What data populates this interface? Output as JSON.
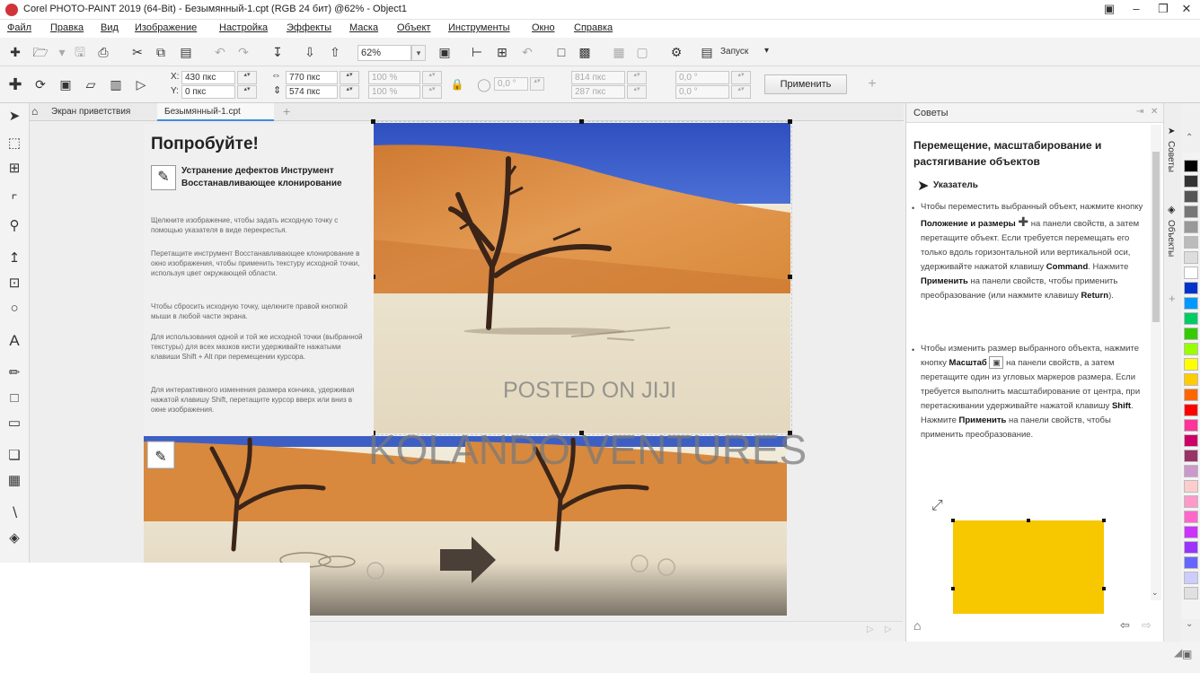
{
  "app": {
    "title": "Corel PHOTO-PAINT 2019 (64-Bit) - Безымянный-1.cpt (RGB 24 бит) @62% - Object1"
  },
  "menu": [
    "Файл",
    "Правка",
    "Вид",
    "Изображение",
    "Настройка",
    "Эффекты",
    "Маска",
    "Объект",
    "Инструменты",
    "Окно",
    "Справка"
  ],
  "toolbar1": {
    "zoom_value": "62%",
    "run_label": "Запуск"
  },
  "toolbar2": {
    "x_label": "X:",
    "y_label": "Y:",
    "x_value": "430 пкс",
    "y_value": "0 пкс",
    "w_value": "770 пкс",
    "h_value": "574 пкс",
    "scale_w": "100 %",
    "scale_h": "100 %",
    "angle": "0,0 °",
    "cx": "814 пкс",
    "cy": "287 пкс",
    "skew_h": "0,0 °",
    "skew_v": "0,0 °",
    "apply_label": "Применить"
  },
  "doc_tabs": [
    "Экран приветствия",
    "Безымянный-1.cpt"
  ],
  "try_panel": {
    "title": "Попробуйте!",
    "heading": "Устранение дефектов Инструмент Восстанавливающее клонирование",
    "paragraphs": [
      "Щелкните изображение, чтобы задать исходную точку с помощью указателя в виде перекрестья.",
      "Перетащите инструмент Восстанавливающее клонирование в окно изображения, чтобы применить текстуру исходной точки, используя цвет окружающей области.",
      "Чтобы сбросить исходную точку, щелкните правой кнопкой мыши в любой части экрана.",
      "Для использования одной и той же исходной точки (выбранной текстуры) для всех мазков кисти удерживайте нажатыми клавиши Shift + Alt при перемещении курсора.",
      "Для интерактивного изменения размера кончика, удерживая нажатой клавишу Shift, перетащите курсор вверх или вниз в окне изображения."
    ]
  },
  "watermarks": {
    "line1": "POSTED ON JIJI",
    "line2": "KOLANDO VENTURES"
  },
  "hints_panel": {
    "header": "Советы",
    "title": "Перемещение, масштабирование и растягивание объектов",
    "pointer_label": "Указатель",
    "bullet1": {
      "a": "Чтобы переместить выбранный объект, нажмите кнопку ",
      "b": "Положение и размеры",
      "c": " на панели свойств, а затем перетащите объект. Если требуется перемещать его только вдоль горизонтальной или вертикальной оси, удерживайте нажатой клавишу ",
      "d": "Command",
      "e": ". Нажмите ",
      "f": "Применить",
      "g": " на панели свойств, чтобы применить преобразование (или нажмите клавишу ",
      "h": "Return",
      "i": ")."
    },
    "bullet2": {
      "a": "Чтобы изменить размер выбранного объекта, нажмите кнопку ",
      "b": "Масштаб",
      "c": " на панели свойств, а затем перетащите один из угловых маркеров размера. Если требуется выполнить масштабирование от центра, при перетаскивании удерживайте нажатой клавишу ",
      "d": "Shift",
      "e": ". Нажмите ",
      "f": "Применить",
      "g": " на панели свойств, чтобы применить преобразование."
    }
  },
  "side_tabs": [
    "Советы",
    "Объекты"
  ],
  "colors": {
    "accent": "#3e8ede",
    "sky": "#3d5fc4",
    "dune": "#d98a3a",
    "demo_rect": "#f7c700"
  },
  "palette": [
    "#000000",
    "#333333",
    "#555555",
    "#777777",
    "#999999",
    "#bbbbbb",
    "#dddddd",
    "#ffffff",
    "#0033cc",
    "#0099ff",
    "#00cc66",
    "#33cc00",
    "#99ff00",
    "#ffff00",
    "#ffcc00",
    "#ff6600",
    "#ff0000",
    "#ff3399",
    "#cc0066",
    "#993366",
    "#cc99cc",
    "#ffcccc",
    "#ff99cc",
    "#ff66cc",
    "#cc33ff",
    "#9933ff",
    "#6666ff",
    "#ccccff",
    "#e0e0e0"
  ]
}
